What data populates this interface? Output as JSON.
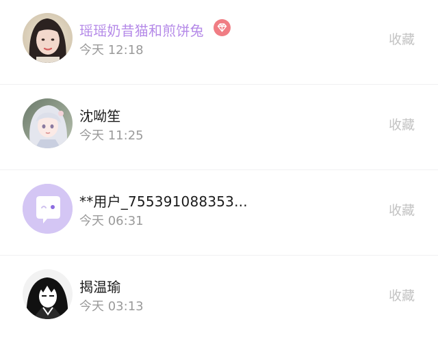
{
  "users": [
    {
      "name": "瑶瑶奶昔猫和煎饼兔",
      "time": "今天 12:18",
      "action": "收藏",
      "vip": true,
      "avatar": "avatar-photo-girl"
    },
    {
      "name": "沈呦笙",
      "time": "今天 11:25",
      "action": "收藏",
      "vip": false,
      "avatar": "avatar-anime-girl"
    },
    {
      "name": "**用户_755391088353...",
      "time": "今天 06:31",
      "action": "收藏",
      "vip": false,
      "avatar": "avatar-default-chat"
    },
    {
      "name": "揭温瑜",
      "time": "今天 03:13",
      "action": "收藏",
      "vip": false,
      "avatar": "avatar-monochrome-art"
    }
  ],
  "colors": {
    "vip_name": "#b58ae8",
    "vip_badge": "#f07d84",
    "default_avatar_bg": "#d4c6f4",
    "action_text": "#c3c3c3",
    "time_text": "#9a9a9a"
  },
  "icons": {
    "vip_badge": "diamond-icon",
    "default_avatar": "chat-bubble-icon"
  }
}
